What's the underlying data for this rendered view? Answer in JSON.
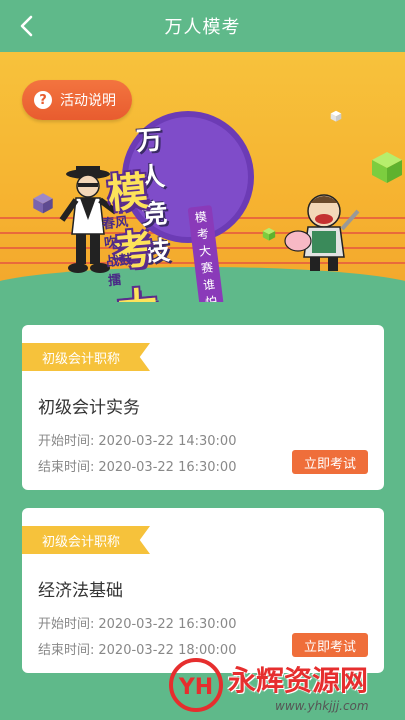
{
  "nav": {
    "title": "万人模考",
    "back_icon": "chevron-left-icon"
  },
  "banner": {
    "help_label": "活动说明",
    "help_icon": "question-icon",
    "title_line1": "万人竞技",
    "title_line2": "模考大赛",
    "slogan": "春风吹，战鼓擂",
    "sub_slogan": "模考大赛谁怕谁"
  },
  "exams": [
    {
      "tag": "初级会计职称",
      "course": "初级会计实务",
      "start_label": "开始时间:",
      "start_time": "2020-03-22 14:30:00",
      "end_label": "结束时间:",
      "end_time": "2020-03-22 16:30:00",
      "button": "立即考试"
    },
    {
      "tag": "初级会计职称",
      "course": "经济法基础",
      "start_label": "开始时间:",
      "start_time": "2020-03-22 16:30:00",
      "end_label": "结束时间:",
      "end_time": "2020-03-22 18:00:00",
      "button": "立即考试"
    }
  ],
  "watermark": {
    "brand": "永辉资源网",
    "url": "www.yhkjjj.com",
    "logo": "YH"
  },
  "colors": {
    "header_green": "#5fb98a",
    "accent_orange": "#ef6e3a",
    "tag_yellow": "#f6c23b"
  }
}
